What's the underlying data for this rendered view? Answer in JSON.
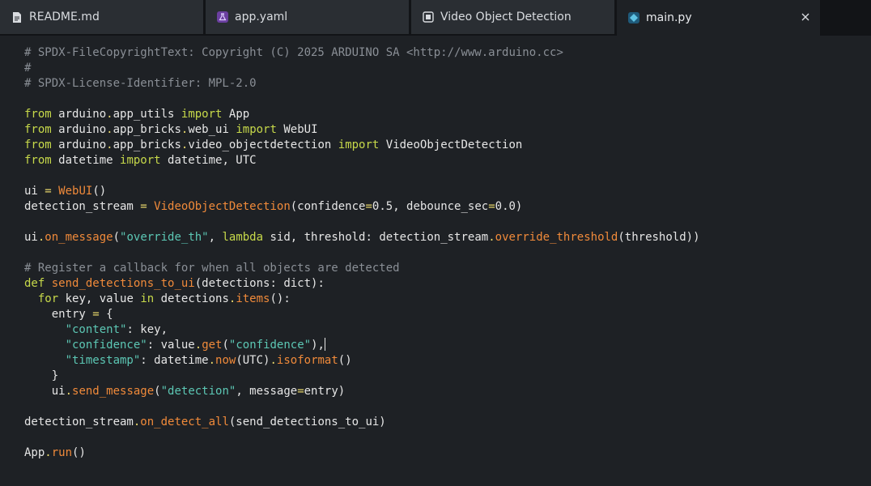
{
  "tabs": [
    {
      "label": "README.md",
      "icon": "file-text-icon"
    },
    {
      "label": "app.yaml",
      "icon": "flask-icon"
    },
    {
      "label": "Video Object Detection",
      "icon": "video-brick-icon"
    },
    {
      "label": "main.py",
      "icon": "python-diamond-icon",
      "active": true,
      "close_icon": "close-icon"
    }
  ],
  "colors": {
    "comment": "#8a8f96",
    "keyword": "#c7d94a",
    "function": "#f08a3a",
    "string": "#5cc7b4",
    "operator": "#e9d86b",
    "text": "#e6e6e6",
    "background": "#1e2125",
    "tabbar": "#121417"
  },
  "code": {
    "lines": [
      [
        [
          "c",
          "# SPDX-FileCopyrightText: Copyright (C) 2025 ARDUINO SA <http://www.arduino.cc>"
        ]
      ],
      [
        [
          "c",
          "#"
        ]
      ],
      [
        [
          "c",
          "# SPDX-License-Identifier: MPL-2.0"
        ]
      ],
      [],
      [
        [
          "k",
          "from"
        ],
        [
          "t",
          " arduino"
        ],
        [
          "o",
          "."
        ],
        [
          "t",
          "app_utils "
        ],
        [
          "k",
          "import"
        ],
        [
          "t",
          " App"
        ]
      ],
      [
        [
          "k",
          "from"
        ],
        [
          "t",
          " arduino"
        ],
        [
          "o",
          "."
        ],
        [
          "t",
          "app_bricks"
        ],
        [
          "o",
          "."
        ],
        [
          "t",
          "web_ui "
        ],
        [
          "k",
          "import"
        ],
        [
          "t",
          " WebUI"
        ]
      ],
      [
        [
          "k",
          "from"
        ],
        [
          "t",
          " arduino"
        ],
        [
          "o",
          "."
        ],
        [
          "t",
          "app_bricks"
        ],
        [
          "o",
          "."
        ],
        [
          "t",
          "video_objectdetection "
        ],
        [
          "k",
          "import"
        ],
        [
          "t",
          " VideoObjectDetection"
        ]
      ],
      [
        [
          "k",
          "from"
        ],
        [
          "t",
          " datetime "
        ],
        [
          "k",
          "import"
        ],
        [
          "t",
          " datetime, UTC"
        ]
      ],
      [],
      [
        [
          "t",
          "ui "
        ],
        [
          "o",
          "="
        ],
        [
          "t",
          " "
        ],
        [
          "f",
          "WebUI"
        ],
        [
          "t",
          "()"
        ]
      ],
      [
        [
          "t",
          "detection_stream "
        ],
        [
          "o",
          "="
        ],
        [
          "t",
          " "
        ],
        [
          "f",
          "VideoObjectDetection"
        ],
        [
          "t",
          "(confidence"
        ],
        [
          "o",
          "="
        ],
        [
          "t",
          "0.5, debounce_sec"
        ],
        [
          "o",
          "="
        ],
        [
          "t",
          "0.0)"
        ]
      ],
      [],
      [
        [
          "t",
          "ui"
        ],
        [
          "o",
          "."
        ],
        [
          "f",
          "on_message"
        ],
        [
          "t",
          "("
        ],
        [
          "s",
          "\"override_th\""
        ],
        [
          "t",
          ", "
        ],
        [
          "k",
          "lambda"
        ],
        [
          "t",
          " sid, threshold: detection_stream"
        ],
        [
          "o",
          "."
        ],
        [
          "f",
          "override_threshold"
        ],
        [
          "t",
          "(threshold))"
        ]
      ],
      [],
      [
        [
          "c",
          "# Register a callback for when all objects are detected"
        ]
      ],
      [
        [
          "k",
          "def"
        ],
        [
          "t",
          " "
        ],
        [
          "f",
          "send_detections_to_ui"
        ],
        [
          "t",
          "(detections: dict):"
        ]
      ],
      [
        [
          "t",
          "  "
        ],
        [
          "k",
          "for"
        ],
        [
          "t",
          " key, value "
        ],
        [
          "k",
          "in"
        ],
        [
          "t",
          " detections"
        ],
        [
          "o",
          "."
        ],
        [
          "f",
          "items"
        ],
        [
          "t",
          "():"
        ]
      ],
      [
        [
          "t",
          "    entry "
        ],
        [
          "o",
          "="
        ],
        [
          "t",
          " {"
        ]
      ],
      [
        [
          "t",
          "      "
        ],
        [
          "s",
          "\"content\""
        ],
        [
          "t",
          ": key,"
        ]
      ],
      [
        [
          "t",
          "      "
        ],
        [
          "s",
          "\"confidence\""
        ],
        [
          "t",
          ": value"
        ],
        [
          "o",
          "."
        ],
        [
          "f",
          "get"
        ],
        [
          "t",
          "("
        ],
        [
          "s",
          "\"confidence\""
        ],
        [
          "t",
          "),"
        ],
        [
          "caret",
          ""
        ]
      ],
      [
        [
          "t",
          "      "
        ],
        [
          "s",
          "\"timestamp\""
        ],
        [
          "t",
          ": datetime"
        ],
        [
          "o",
          "."
        ],
        [
          "f",
          "now"
        ],
        [
          "t",
          "(UTC)"
        ],
        [
          "o",
          "."
        ],
        [
          "f",
          "isoformat"
        ],
        [
          "t",
          "()"
        ]
      ],
      [
        [
          "t",
          "    }"
        ]
      ],
      [
        [
          "t",
          "    ui"
        ],
        [
          "o",
          "."
        ],
        [
          "f",
          "send_message"
        ],
        [
          "t",
          "("
        ],
        [
          "s",
          "\"detection\""
        ],
        [
          "t",
          ", message"
        ],
        [
          "o",
          "="
        ],
        [
          "t",
          "entry)"
        ]
      ],
      [],
      [
        [
          "t",
          "detection_stream"
        ],
        [
          "o",
          "."
        ],
        [
          "f",
          "on_detect_all"
        ],
        [
          "t",
          "(send_detections_to_ui)"
        ]
      ],
      [],
      [
        [
          "t",
          "App"
        ],
        [
          "o",
          "."
        ],
        [
          "f",
          "run"
        ],
        [
          "t",
          "()"
        ]
      ]
    ]
  }
}
